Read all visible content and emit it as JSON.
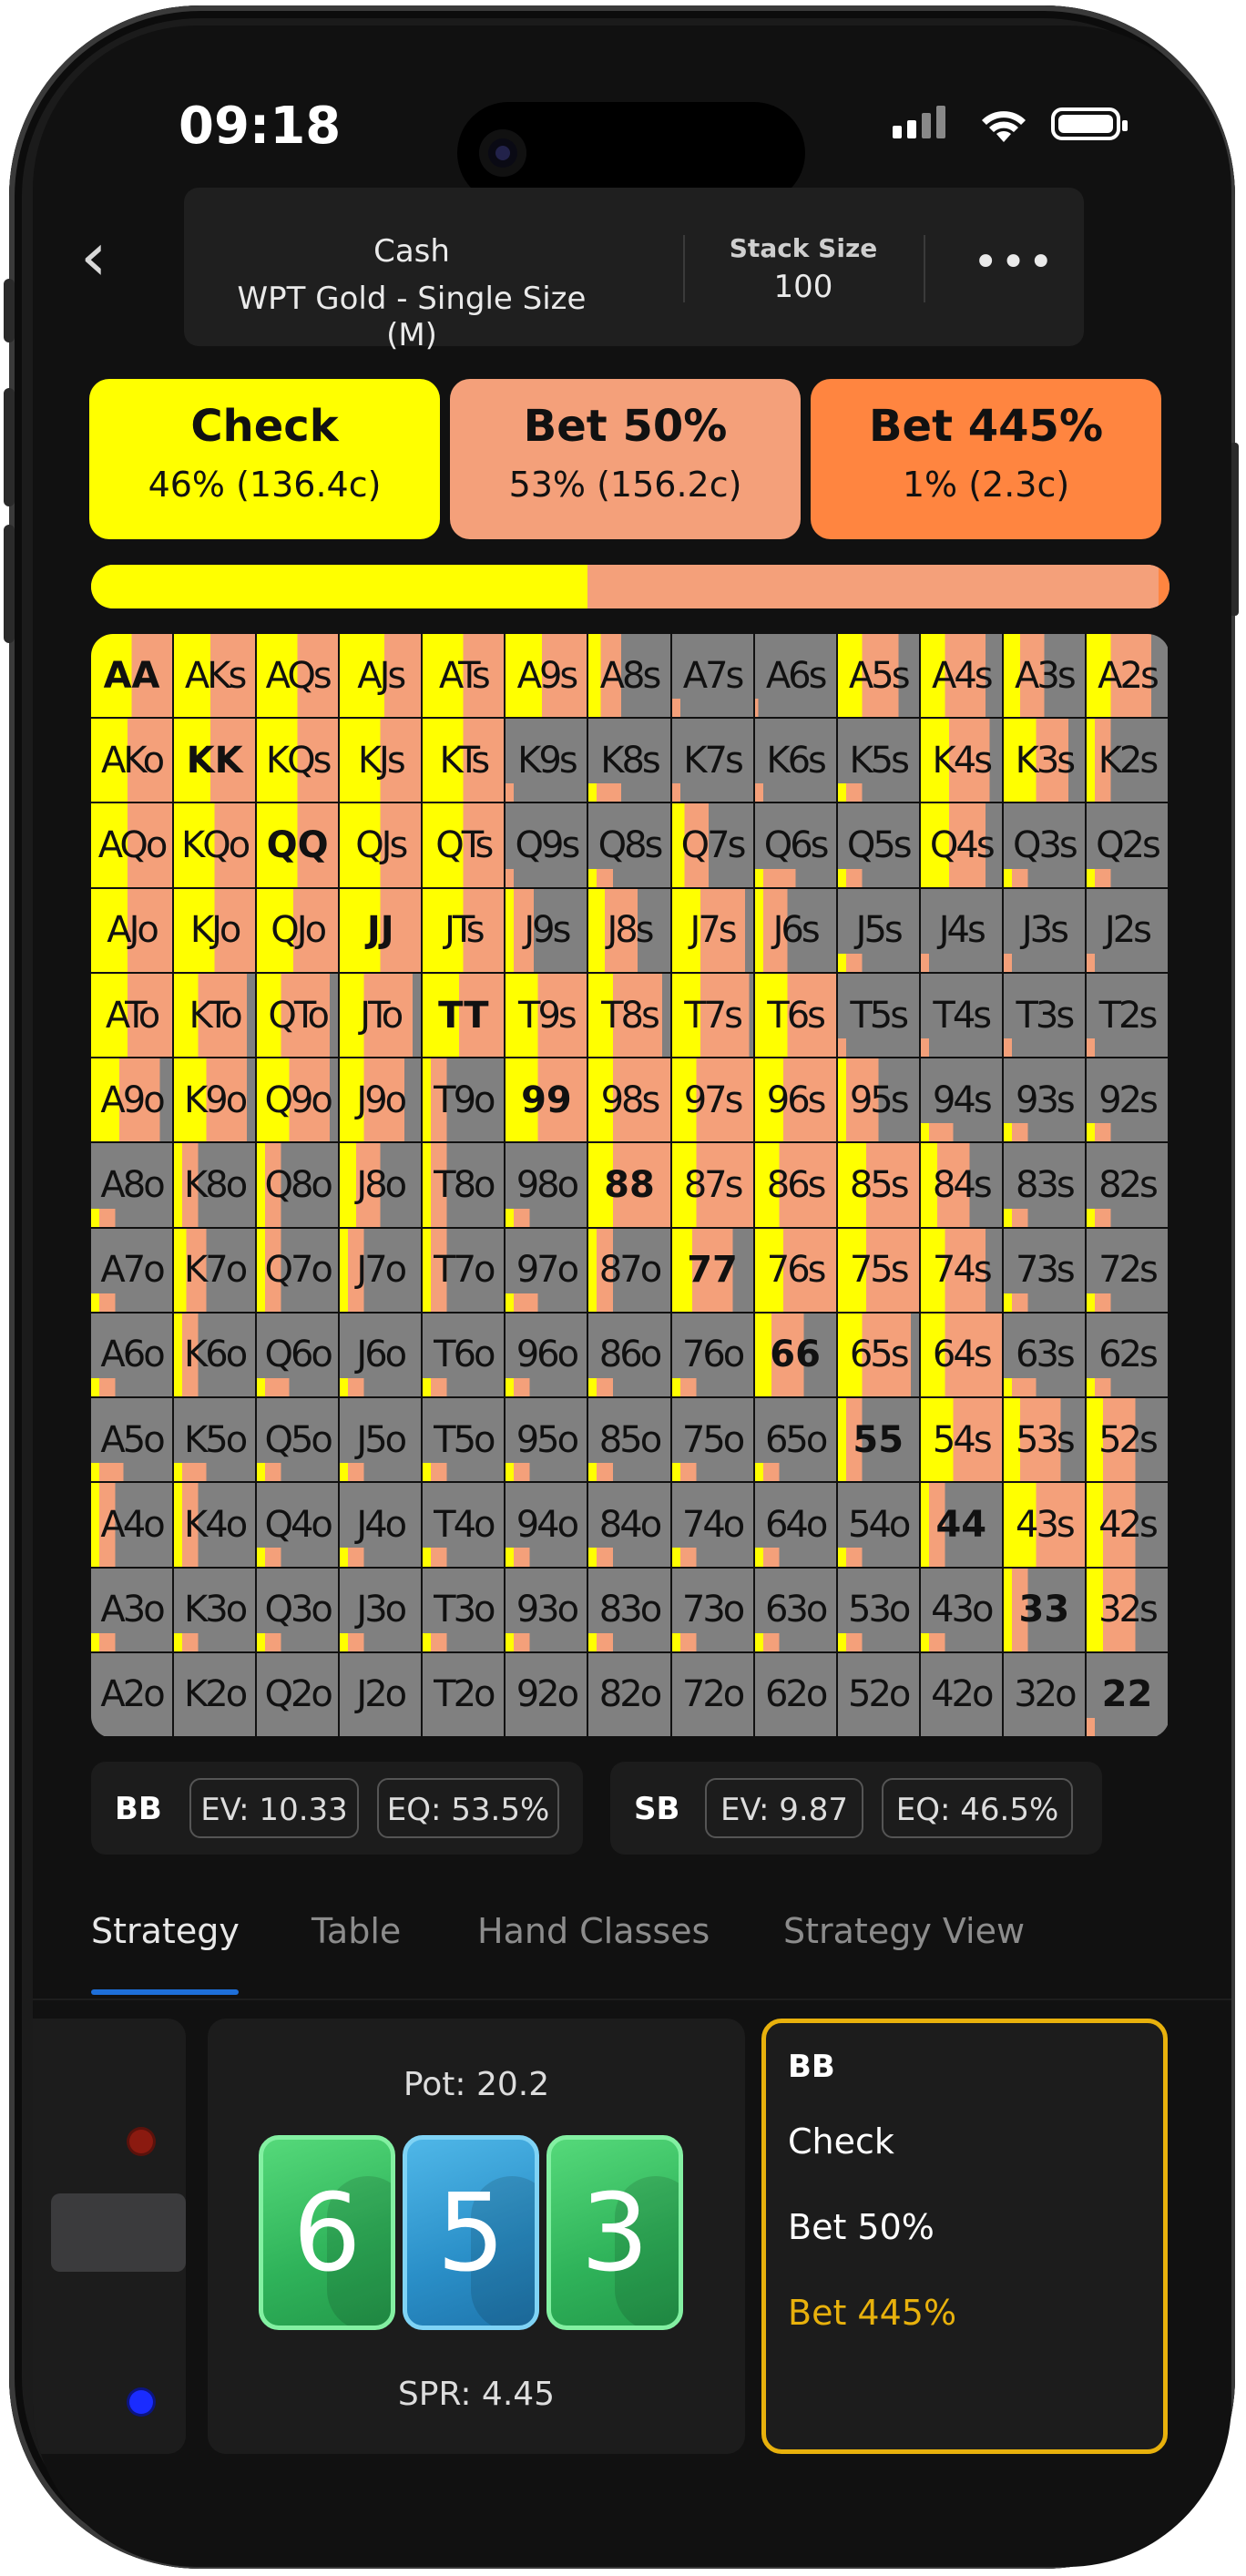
{
  "status": {
    "time": "09:18"
  },
  "header": {
    "game_type": "Cash",
    "format": "WPT Gold - Single Size (M)",
    "stack_label": "Stack Size",
    "stack_value": "100"
  },
  "actions": [
    {
      "name": "Check",
      "detail": "46% (136.4c)",
      "color": "#ffff00",
      "fraction": 0.46
    },
    {
      "name": "Bet 50%",
      "detail": "53% (156.2c)",
      "color": "#f4a07a",
      "fraction": 0.53
    },
    {
      "name": "Bet 445%",
      "detail": "1% (2.3c)",
      "color": "#ff8540",
      "fraction": 0.01
    }
  ],
  "grid": {
    "ranks": [
      "A",
      "K",
      "Q",
      "J",
      "T",
      "9",
      "8",
      "7",
      "6",
      "5",
      "4",
      "3",
      "2"
    ],
    "colors": {
      "check": "#ffff00",
      "bet50": "#f4a07a",
      "bet445": "#ff8540",
      "fold": "#808080",
      "pair_light": "#bdbdbd"
    },
    "strategy": [
      [
        [
          0.5,
          0.5,
          0
        ],
        [
          0.45,
          0.55,
          0
        ],
        [
          0.5,
          0.5,
          0
        ],
        [
          0.55,
          0.45,
          0
        ],
        [
          0.5,
          0.5,
          0
        ],
        [
          0.45,
          0.55,
          0
        ],
        [
          0.15,
          0.25,
          0
        ],
        [
          0,
          0.05,
          0
        ],
        [
          0,
          0.02,
          0
        ],
        [
          0.3,
          0.45,
          0
        ],
        [
          0.3,
          0.5,
          0
        ],
        [
          0.2,
          0.3,
          0
        ],
        [
          0.3,
          0.5,
          0
        ]
      ],
      [
        [
          0.45,
          0.55,
          0
        ],
        [
          0.45,
          0.55,
          0
        ],
        [
          0.5,
          0.5,
          0
        ],
        [
          0.5,
          0.5,
          0
        ],
        [
          0.5,
          0.5,
          0
        ],
        [
          0,
          0.05,
          0
        ],
        [
          0.05,
          0.15,
          0
        ],
        [
          0,
          0.05,
          0
        ],
        [
          0,
          0.05,
          0
        ],
        [
          0.05,
          0.1,
          0
        ],
        [
          0.35,
          0.5,
          0
        ],
        [
          0.4,
          0.4,
          0
        ],
        [
          0.1,
          0.2,
          0
        ]
      ],
      [
        [
          0.45,
          0.55,
          0
        ],
        [
          0.5,
          0.5,
          0
        ],
        [
          0.5,
          0.5,
          0
        ],
        [
          0.5,
          0.5,
          0
        ],
        [
          0.5,
          0.5,
          0
        ],
        [
          0,
          0.05,
          0
        ],
        [
          0.05,
          0.1,
          0
        ],
        [
          0.15,
          0.3,
          0
        ],
        [
          0.05,
          0.2,
          0
        ],
        [
          0.05,
          0.1,
          0
        ],
        [
          0.35,
          0.45,
          0
        ],
        [
          0.05,
          0.1,
          0
        ],
        [
          0.05,
          0.1,
          0
        ]
      ],
      [
        [
          0.45,
          0.55,
          0
        ],
        [
          0.5,
          0.5,
          0
        ],
        [
          0.45,
          0.55,
          0
        ],
        [
          0.5,
          0.5,
          0
        ],
        [
          0.5,
          0.5,
          0
        ],
        [
          0.1,
          0.25,
          0
        ],
        [
          0.2,
          0.4,
          0
        ],
        [
          0.35,
          0.55,
          0
        ],
        [
          0.1,
          0.3,
          0
        ],
        [
          0.05,
          0.1,
          0
        ],
        [
          0,
          0.05,
          0
        ],
        [
          0,
          0.05,
          0
        ],
        [
          0,
          0.05,
          0
        ]
      ],
      [
        [
          0.45,
          0.55,
          0
        ],
        [
          0.3,
          0.6,
          0
        ],
        [
          0.3,
          0.6,
          0
        ],
        [
          0.3,
          0.6,
          0
        ],
        [
          0.45,
          0.55,
          0
        ],
        [
          0.4,
          0.6,
          0
        ],
        [
          0.3,
          0.6,
          0
        ],
        [
          0.35,
          0.6,
          0
        ],
        [
          0.4,
          0.6,
          0
        ],
        [
          0,
          0.05,
          0
        ],
        [
          0,
          0.05,
          0
        ],
        [
          0,
          0.05,
          0
        ],
        [
          0,
          0.05,
          0
        ]
      ],
      [
        [
          0.35,
          0.5,
          0
        ],
        [
          0.4,
          0.5,
          0
        ],
        [
          0.4,
          0.5,
          0
        ],
        [
          0.3,
          0.5,
          0
        ],
        [
          0.1,
          0.2,
          0
        ],
        [
          0.4,
          0.6,
          0
        ],
        [
          0.3,
          0.7,
          0
        ],
        [
          0.3,
          0.7,
          0
        ],
        [
          0.35,
          0.65,
          0
        ],
        [
          0.1,
          0.4,
          0
        ],
        [
          0.05,
          0.15,
          0
        ],
        [
          0.05,
          0.1,
          0
        ],
        [
          0.05,
          0.1,
          0
        ]
      ],
      [
        [
          0.05,
          0.1,
          0
        ],
        [
          0.1,
          0.2,
          0
        ],
        [
          0.1,
          0.2,
          0
        ],
        [
          0.2,
          0.3,
          0
        ],
        [
          0.1,
          0.2,
          0
        ],
        [
          0.05,
          0.1,
          0
        ],
        [
          0.3,
          0.7,
          0
        ],
        [
          0.3,
          0.7,
          0
        ],
        [
          0.3,
          0.7,
          0
        ],
        [
          0.35,
          0.65,
          0
        ],
        [
          0.2,
          0.4,
          0
        ],
        [
          0.05,
          0.1,
          0
        ],
        [
          0.05,
          0.1,
          0
        ]
      ],
      [
        [
          0.05,
          0.1,
          0
        ],
        [
          0.15,
          0.25,
          0
        ],
        [
          0.1,
          0.2,
          0
        ],
        [
          0.1,
          0.2,
          0
        ],
        [
          0.1,
          0.2,
          0
        ],
        [
          0.05,
          0.15,
          0
        ],
        [
          0.1,
          0.2,
          0
        ],
        [
          0.25,
          0.5,
          0
        ],
        [
          0.35,
          0.65,
          0
        ],
        [
          0.35,
          0.65,
          0
        ],
        [
          0.3,
          0.5,
          0
        ],
        [
          0.05,
          0.1,
          0
        ],
        [
          0.05,
          0.1,
          0
        ]
      ],
      [
        [
          0.05,
          0.1,
          0
        ],
        [
          0.1,
          0.2,
          0
        ],
        [
          0.05,
          0.15,
          0
        ],
        [
          0.05,
          0.1,
          0
        ],
        [
          0.05,
          0.1,
          0
        ],
        [
          0.05,
          0.1,
          0
        ],
        [
          0.05,
          0.1,
          0
        ],
        [
          0.05,
          0.1,
          0
        ],
        [
          0.2,
          0.4,
          0
        ],
        [
          0.3,
          0.6,
          0
        ],
        [
          0.3,
          0.7,
          0
        ],
        [
          0.05,
          0.15,
          0
        ],
        [
          0.05,
          0.1,
          0
        ]
      ],
      [
        [
          0.05,
          0.15,
          0
        ],
        [
          0.05,
          0.15,
          0
        ],
        [
          0.05,
          0.1,
          0
        ],
        [
          0.05,
          0.1,
          0
        ],
        [
          0.05,
          0.1,
          0
        ],
        [
          0.05,
          0.1,
          0
        ],
        [
          0.05,
          0.1,
          0
        ],
        [
          0.05,
          0.1,
          0
        ],
        [
          0.05,
          0.1,
          0
        ],
        [
          0.1,
          0.2,
          0
        ],
        [
          0.4,
          0.6,
          0
        ],
        [
          0.2,
          0.5,
          0
        ],
        [
          0.2,
          0.4,
          0
        ]
      ],
      [
        [
          0.1,
          0.2,
          0
        ],
        [
          0.1,
          0.2,
          0
        ],
        [
          0.05,
          0.1,
          0
        ],
        [
          0.05,
          0.1,
          0
        ],
        [
          0.05,
          0.1,
          0
        ],
        [
          0.05,
          0.1,
          0
        ],
        [
          0.05,
          0.1,
          0
        ],
        [
          0.05,
          0.1,
          0
        ],
        [
          0.05,
          0.1,
          0
        ],
        [
          0.05,
          0.1,
          0
        ],
        [
          0.1,
          0.2,
          0
        ],
        [
          0.4,
          0.6,
          0
        ],
        [
          0.2,
          0.4,
          0
        ]
      ],
      [
        [
          0.05,
          0.1,
          0
        ],
        [
          0.05,
          0.1,
          0
        ],
        [
          0.05,
          0.1,
          0
        ],
        [
          0.05,
          0.1,
          0
        ],
        [
          0.05,
          0.1,
          0
        ],
        [
          0.05,
          0.1,
          0
        ],
        [
          0.05,
          0.1,
          0
        ],
        [
          0.05,
          0.1,
          0
        ],
        [
          0.05,
          0.1,
          0
        ],
        [
          0.05,
          0.1,
          0
        ],
        [
          0.05,
          0.1,
          0
        ],
        [
          0.1,
          0.2,
          0
        ],
        [
          0.2,
          0.4,
          0
        ]
      ],
      [
        [
          0,
          0,
          0
        ],
        [
          0,
          0,
          0
        ],
        [
          0,
          0,
          0
        ],
        [
          0,
          0,
          0
        ],
        [
          0,
          0,
          0
        ],
        [
          0,
          0,
          0
        ],
        [
          0,
          0,
          0
        ],
        [
          0,
          0,
          0
        ],
        [
          0,
          0,
          0
        ],
        [
          0,
          0,
          0
        ],
        [
          0,
          0,
          0
        ],
        [
          0,
          0,
          0
        ],
        [
          0,
          0.05,
          0
        ]
      ]
    ]
  },
  "players": [
    {
      "name": "BB",
      "ev": "EV: 10.33",
      "eq": "EQ: 53.5%"
    },
    {
      "name": "SB",
      "ev": "EV: 9.87",
      "eq": "EQ: 46.5%"
    }
  ],
  "tabs": [
    "Strategy",
    "Table",
    "Hand Classes",
    "Strategy View"
  ],
  "board": {
    "pot": "Pot:  20.2",
    "spr": "SPR:  4.45",
    "cards": [
      {
        "rank": "6",
        "suit_color": "green"
      },
      {
        "rank": "5",
        "suit_color": "blue"
      },
      {
        "rank": "3",
        "suit_color": "green"
      }
    ]
  },
  "legend": {
    "title": "BB",
    "items": [
      {
        "label": "Check",
        "color": "#ffffff"
      },
      {
        "label": "Bet 50%",
        "color": "#ffffff"
      },
      {
        "label": "Bet 445%",
        "color": "#e8b10c"
      }
    ]
  },
  "left_panel": {
    "dot_top_color": "#8b1a10",
    "dot_bottom_color": "#1a2cff"
  }
}
